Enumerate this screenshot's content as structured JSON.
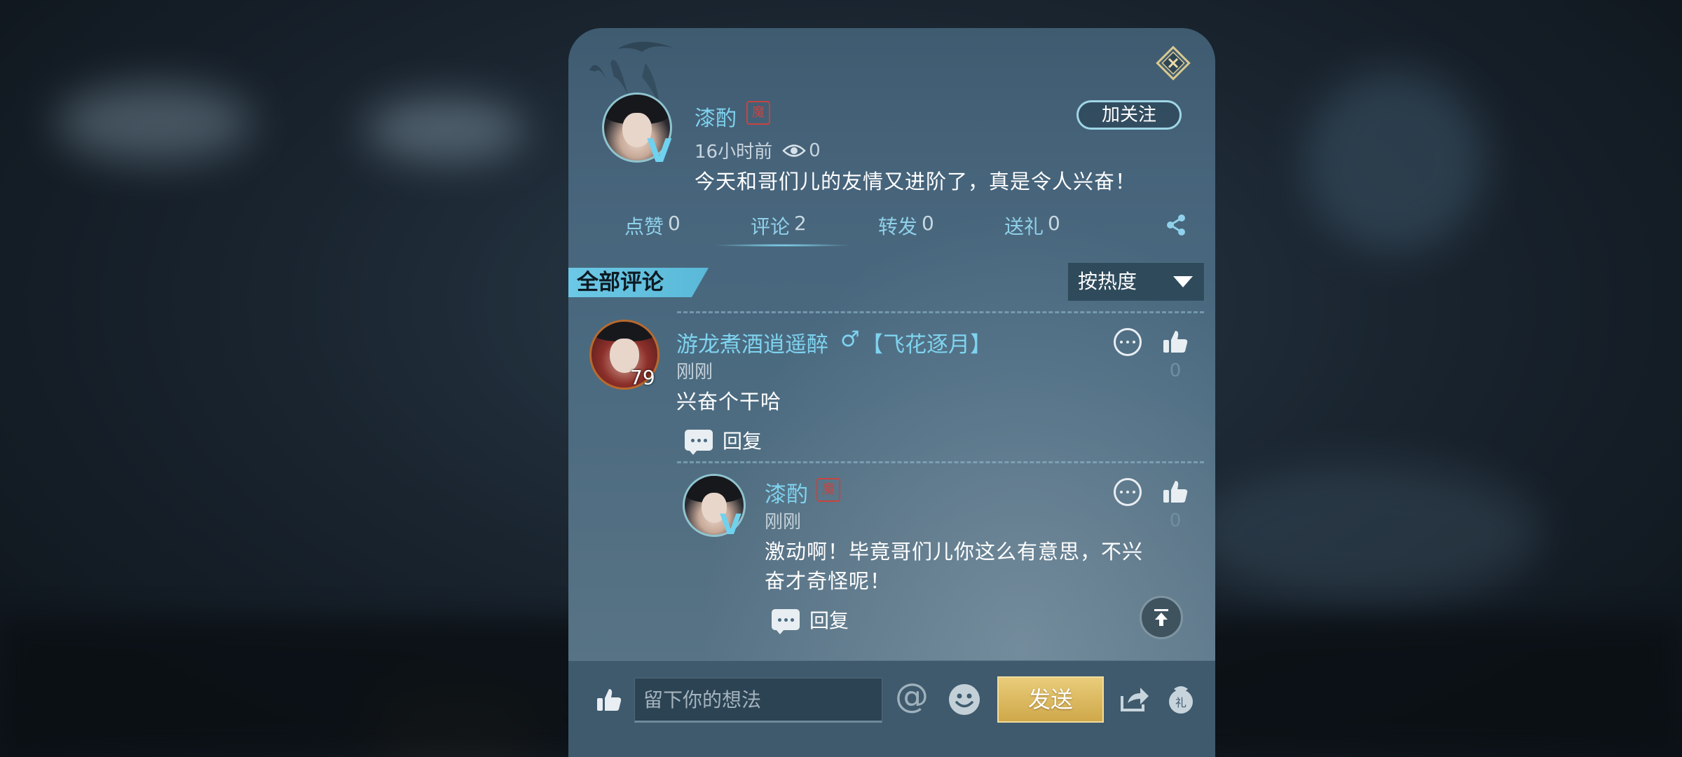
{
  "post": {
    "author_name": "漆酌",
    "seal_char": "魔",
    "time": "16小时前",
    "view_count": "0",
    "text": "今天和哥们儿的友情又进阶了，真是令人兴奋！",
    "follow_label": "加关注"
  },
  "stats": [
    {
      "label": "点赞",
      "value": "0"
    },
    {
      "label": "评论",
      "value": "2"
    },
    {
      "label": "转发",
      "value": "0"
    },
    {
      "label": "送礼",
      "value": "0"
    }
  ],
  "comments_section": {
    "title": "全部评论",
    "sort_selected": "按热度"
  },
  "comments": [
    {
      "name": "游龙煮酒逍遥醉",
      "gender": "♂",
      "tag": "【飞花逐月】",
      "level": "79",
      "time": "刚刚",
      "text": "兴奋个干哈",
      "likes": "0",
      "reply_label": "回复"
    },
    {
      "name": "漆酌",
      "seal_char": "魔",
      "time": "刚刚",
      "text_line1": "激动啊！毕竟哥们儿你这么有意思，不兴",
      "text_line2": "奋才奇怪呢！",
      "likes": "0",
      "reply_label": "回复"
    }
  ],
  "bottom_bar": {
    "input_placeholder": "留下你的想法",
    "at_symbol": "@",
    "send_label": "发送"
  },
  "colors": {
    "accent_cyan": "#7fd3ef",
    "send_gold": "#d9b55e",
    "seal_red": "#c8443f"
  },
  "icons": [
    "close-icon",
    "eye-icon",
    "share-icon",
    "more-icon",
    "thumbs-up-icon",
    "reply-icon",
    "back-to-top-icon",
    "emoji-icon",
    "forward-icon",
    "gift-icon"
  ]
}
